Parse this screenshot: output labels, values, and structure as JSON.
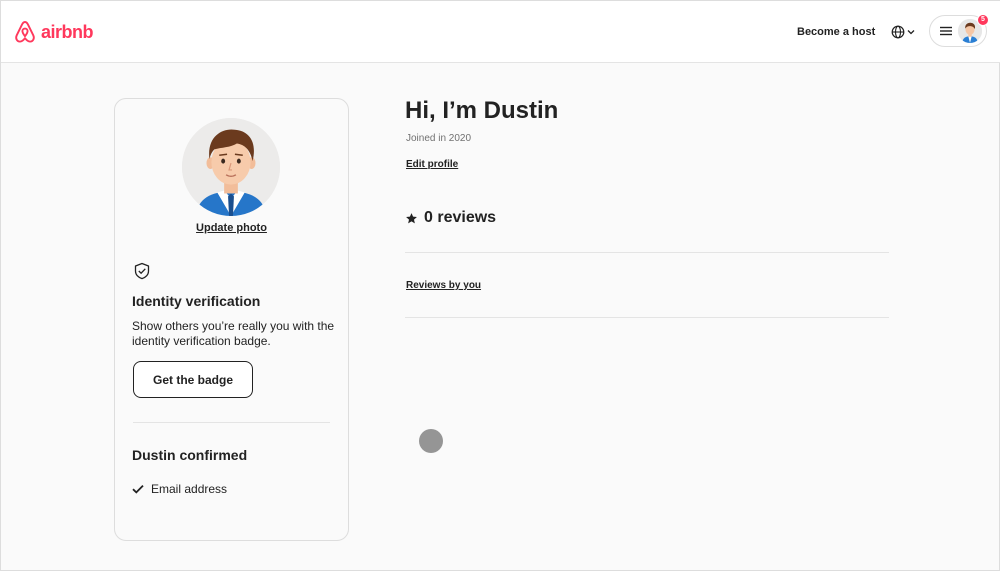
{
  "header": {
    "logo_text": "airbnb",
    "become_host_label": "Become a host",
    "notification_count": "5"
  },
  "profile_card": {
    "update_photo_label": "Update photo",
    "identity_title": "Identity verification",
    "identity_description": "Show others you’re really you with the identity verification badge.",
    "badge_button_label": "Get the badge",
    "confirmed_title": "Dustin confirmed",
    "confirmed_items": [
      {
        "label": "Email address"
      }
    ]
  },
  "main": {
    "greeting": "Hi, I’m Dustin",
    "joined": "Joined in 2020",
    "edit_profile_label": "Edit profile",
    "reviews_count_label": "0 reviews",
    "reviews_by_you_label": "Reviews by you"
  },
  "colors": {
    "brand": "#ff385c",
    "text": "#222222",
    "muted": "#717171",
    "border": "#dddddd"
  },
  "icons": {
    "logo": "airbnb-logo-icon",
    "globe": "globe-icon",
    "menu": "hamburger-menu-icon",
    "shield": "shield-check-icon",
    "star": "star-icon",
    "check": "checkmark-icon"
  }
}
